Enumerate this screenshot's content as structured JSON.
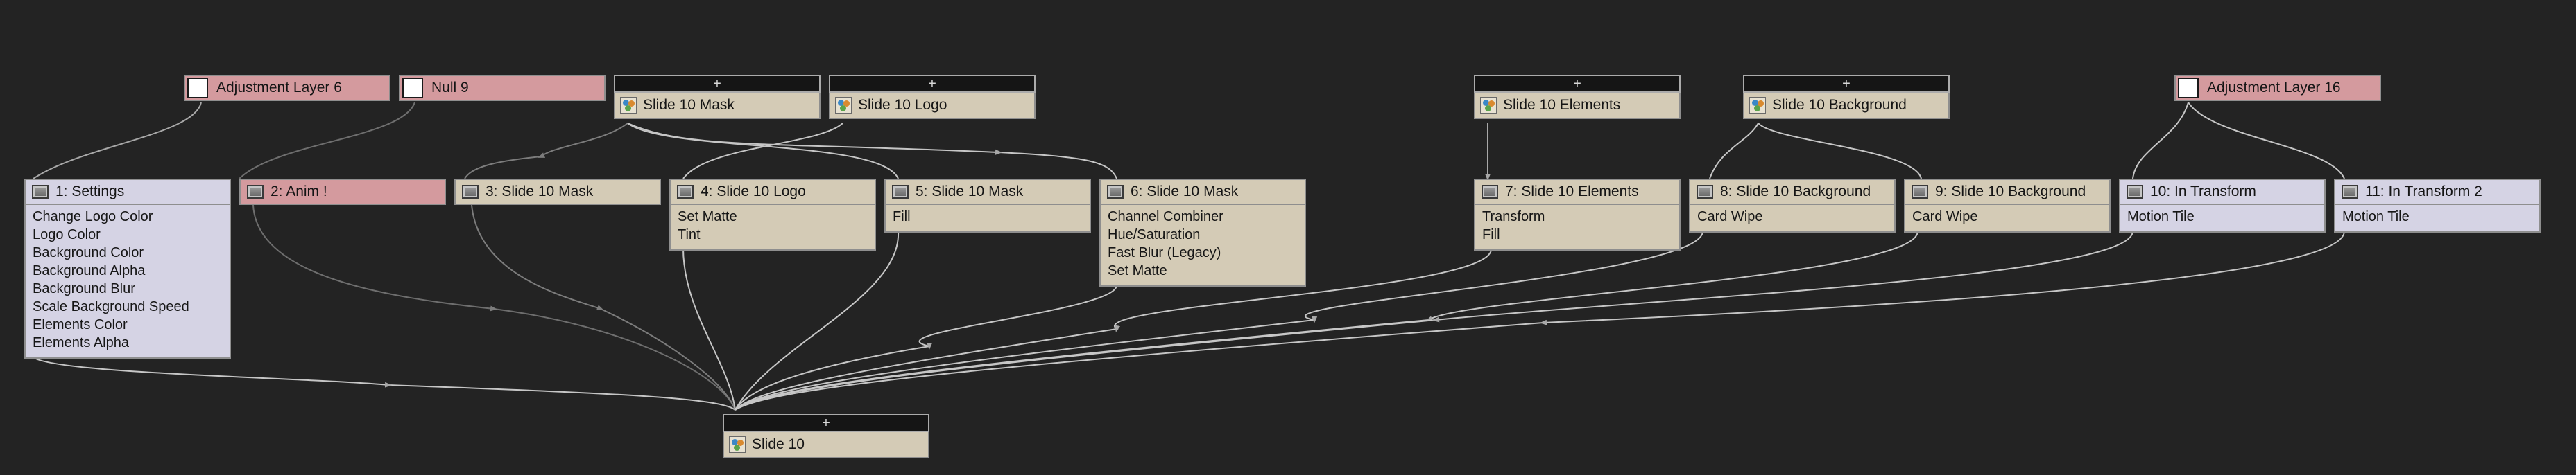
{
  "nodes": {
    "adj6": {
      "label": "Adjustment Layer 6"
    },
    "null9": {
      "label": "Null 9"
    },
    "src_mask": {
      "label": "Slide 10 Mask"
    },
    "src_logo": {
      "label": "Slide 10 Logo"
    },
    "src_elements": {
      "label": "Slide 10 Elements"
    },
    "src_background": {
      "label": "Slide 10 Background"
    },
    "adj16": {
      "label": "Adjustment Layer 16"
    },
    "l1": {
      "label": "1: Settings",
      "effects": [
        "Change Logo Color",
        "Logo Color",
        "Background Color",
        "Background Alpha",
        "Background Blur",
        "Scale Background Speed",
        "Elements Color",
        "Elements Alpha"
      ]
    },
    "l2": {
      "label": "2: Anim !"
    },
    "l3": {
      "label": "3: Slide 10 Mask"
    },
    "l4": {
      "label": "4: Slide 10 Logo",
      "effects": [
        "Set Matte",
        "Tint"
      ]
    },
    "l5": {
      "label": "5: Slide 10 Mask",
      "effects": [
        "Fill"
      ]
    },
    "l6": {
      "label": "6: Slide 10 Mask",
      "effects": [
        "Channel Combiner",
        "Hue/Saturation",
        "Fast Blur (Legacy)",
        "Set Matte"
      ]
    },
    "l7": {
      "label": "7: Slide 10 Elements",
      "effects": [
        "Transform",
        "Fill"
      ]
    },
    "l8": {
      "label": "8: Slide 10 Background",
      "effects": [
        "Card Wipe"
      ]
    },
    "l9": {
      "label": "9: Slide 10 Background",
      "effects": [
        "Card Wipe"
      ]
    },
    "l10": {
      "label": "10: In Transform",
      "effects": [
        "Motion Tile"
      ]
    },
    "l11": {
      "label": "11: In Transform 2",
      "effects": [
        "Motion Tile"
      ]
    },
    "out": {
      "label": "Slide 10"
    }
  },
  "expand_glyph": "+"
}
